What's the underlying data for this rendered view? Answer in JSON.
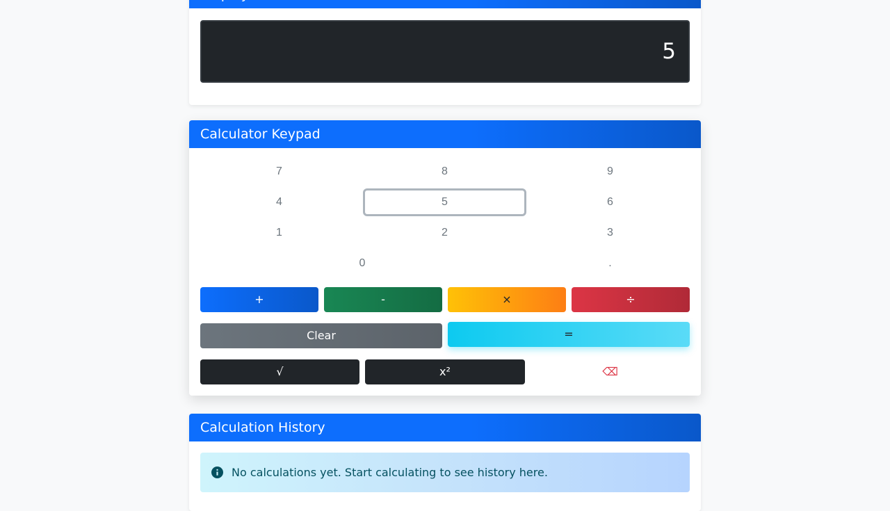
{
  "display": {
    "header_title": "Display",
    "value": "5"
  },
  "keypad": {
    "header_title": "Calculator Keypad",
    "digits": [
      "7",
      "8",
      "9",
      "4",
      "5",
      "6",
      "1",
      "2",
      "3",
      "0",
      "."
    ],
    "operators": {
      "add": "+",
      "subtract": "-",
      "multiply": "×",
      "divide": "÷"
    },
    "clear_label": "Clear",
    "equals_label": "=",
    "sqrt_label": "√",
    "square_label": "x²",
    "backspace_label": "⌫"
  },
  "history": {
    "header_title": "Calculation History",
    "empty_message": "No calculations yet. Start calculating to see history here."
  },
  "colors": {
    "primary": "#0d6efd",
    "success": "#198754",
    "warning": "#ffc107",
    "danger": "#dc3545",
    "secondary": "#6c757d",
    "info": "#0dcaf0",
    "dark": "#212529"
  }
}
